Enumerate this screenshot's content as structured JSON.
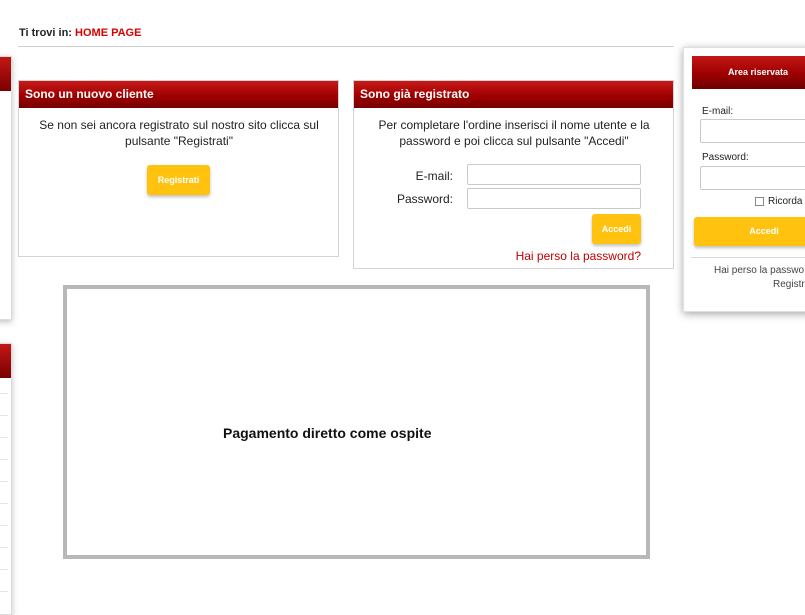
{
  "breadcrumb": {
    "prefix": "Ti trovi in:",
    "current": "HOME PAGE"
  },
  "new_customer": {
    "title": "Sono un nuovo cliente",
    "text": "Se non sei ancora registrato sul nostro sito clicca sul pulsante \"Registrati\"",
    "button": "Registrati"
  },
  "registered": {
    "title": "Sono già registrato",
    "text": "Per completare l'ordine inserisci il nome utente e la password e poi clicca sul pulsante \"Accedi\"",
    "email_label": "E-mail:",
    "password_label": "Password:",
    "button": "Accedi",
    "lost_password": "Hai perso la password?"
  },
  "guest": {
    "label": "Pagamento diretto come ospite"
  },
  "reserved_area": {
    "title": "Area riservata",
    "email_label": "E-mail:",
    "password_label": "Password:",
    "remember_label": "Ricorda",
    "button": "Accedi",
    "lost_password": "Hai perso la passwo",
    "register": "Registr"
  },
  "colors": {
    "accent_red": "#a00000",
    "link_red": "#d80000",
    "button_yellow": "#ffc20e"
  }
}
